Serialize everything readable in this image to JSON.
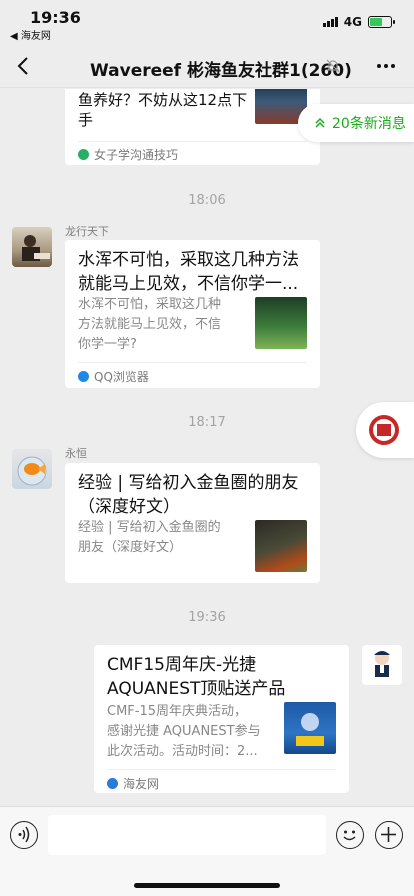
{
  "status": {
    "time": "19:36",
    "back_app": "◀ 海友网",
    "network": "4G"
  },
  "nav": {
    "title": "Wavereef 彬海鱼友社群1(260)"
  },
  "new_messages": {
    "label": "20条新消息"
  },
  "messages": [
    {
      "title_lines": [
        "鱼养好？不妨从这12点下",
        "手"
      ],
      "source": "女子学沟通技巧",
      "source_color": "#2aae67"
    },
    {
      "timestamp": "18:06"
    },
    {
      "sender": "龙行天下",
      "title_lines": [
        "水浑不可怕，采取这几种方法",
        "就能马上见效，不信你学一..."
      ],
      "desc_lines": [
        "水浑不可怕，采取这几种",
        "方法就能马上见效，不信",
        "你学一学?"
      ],
      "source": "QQ浏览器",
      "source_color": "#1e88e5"
    },
    {
      "timestamp": "18:17"
    },
    {
      "sender": "永恒",
      "title_lines": [
        "经验 | 写给初入金鱼圈的朋友",
        "（深度好文）"
      ],
      "desc_lines": [
        "经验 | 写给初入金鱼圈的",
        "朋友（深度好文）"
      ],
      "source": "",
      "source_color": ""
    },
    {
      "timestamp": "19:36"
    },
    {
      "title_lines": [
        "CMF15周年庆-光捷",
        "AQUANEST顶贴送产品"
      ],
      "desc_lines": [
        "CMF-15周年庆典活动，",
        "感谢光捷 AQUANEST参与",
        "此次活动。活动时间：2..."
      ],
      "source": "海友网",
      "source_color": "#2a7bd6"
    }
  ],
  "input": {
    "placeholder": ""
  },
  "colors": {
    "accent_green": "#1aad19",
    "background": "#ededed"
  }
}
